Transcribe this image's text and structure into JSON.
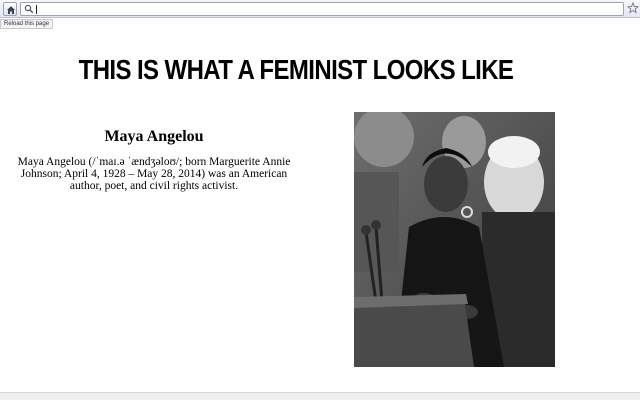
{
  "browser": {
    "address_value": "",
    "tooltip": "Reload this page",
    "icons": {
      "home": "home-icon",
      "search": "search-icon",
      "bookmark": "star-icon"
    }
  },
  "page": {
    "heading": "THIS IS WHAT A FEMINIST LOOKS LIKE",
    "name": "Maya Angelou",
    "bio": "Maya Angelou (/ˈmaɪ.ə ˈændʒəloʊ/; born Marguerite Annie Johnson; April 4, 1928 – May 28, 2014) was an American author, poet, and civil rights activist."
  }
}
